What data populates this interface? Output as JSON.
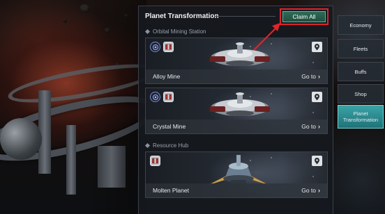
{
  "panel": {
    "title": "Planet Transformation",
    "claim_label": "Claim All"
  },
  "sections": [
    {
      "title": "Orbital Mining Station",
      "cards": [
        {
          "name": "Alloy Mine",
          "goto": "Go to",
          "chevron": "›",
          "icons": [
            "resource-icon",
            "supply-box-icon"
          ]
        },
        {
          "name": "Crystal Mine",
          "goto": "Go to",
          "chevron": "›",
          "icons": [
            "resource-icon",
            "supply-box-icon"
          ]
        }
      ]
    },
    {
      "title": "Resource Hub",
      "cards": [
        {
          "name": "Molten Planet",
          "goto": "Go to",
          "chevron": "›",
          "icons": [
            "supply-box-icon"
          ]
        }
      ]
    }
  ],
  "nav": {
    "items": [
      {
        "label": "Economy",
        "active": false
      },
      {
        "label": "Fleets",
        "active": false
      },
      {
        "label": "Buffs",
        "active": false
      },
      {
        "label": "Shop",
        "active": false
      },
      {
        "label": "Planet Transformation",
        "active": true
      }
    ]
  },
  "colors": {
    "highlight": "#e0242a",
    "claim_button": "#2e6b56",
    "active_nav": "#3aa3a6",
    "resource_icon": "#7a8fd6"
  }
}
